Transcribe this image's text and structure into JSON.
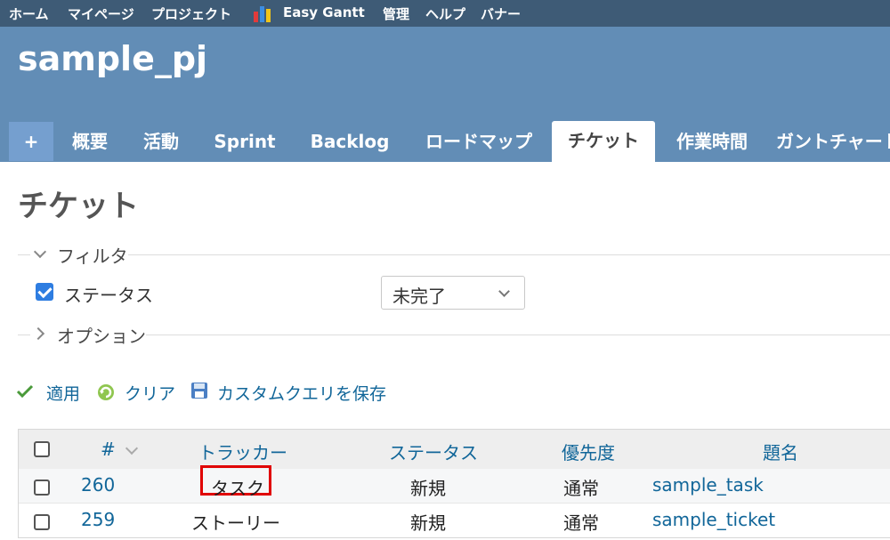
{
  "top_menu": {
    "items": [
      "ホーム",
      "マイページ",
      "プロジェクト",
      "Easy Gantt",
      "管理",
      "ヘルプ",
      "バナー"
    ],
    "easy_gantt_icon": "bar-chart-icon"
  },
  "header": {
    "project_title": "sample_pj"
  },
  "tabs": [
    {
      "label": "+"
    },
    {
      "label": "概要"
    },
    {
      "label": "活動"
    },
    {
      "label": "Sprint"
    },
    {
      "label": "Backlog"
    },
    {
      "label": "ロードマップ"
    },
    {
      "label": "チケット",
      "selected": true
    },
    {
      "label": "作業時間"
    },
    {
      "label": "ガントチャート"
    }
  ],
  "page_title": "チケット",
  "filters": {
    "legend": "フィルタ",
    "status_label": "ステータス",
    "status_checked": true,
    "status_value": "未完了"
  },
  "options": {
    "legend": "オプション"
  },
  "actions": {
    "apply": "適用",
    "clear": "クリア",
    "save_query": "カスタムクエリを保存"
  },
  "table": {
    "columns": [
      "#",
      "トラッカー",
      "ステータス",
      "優先度",
      "題名"
    ],
    "rows": [
      {
        "id": "260",
        "tracker": "タスク",
        "status": "新規",
        "priority": "通常",
        "subject": "sample_task",
        "highlighted": true
      },
      {
        "id": "259",
        "tracker": "ストーリー",
        "status": "新規",
        "priority": "通常",
        "subject": "sample_ticket"
      }
    ]
  },
  "colors": {
    "top_menu_bg": "#3e5b76",
    "header_bg": "#628db6",
    "tab_bg": "#759fcf",
    "link": "#116699",
    "highlight_border": "#e00000"
  }
}
